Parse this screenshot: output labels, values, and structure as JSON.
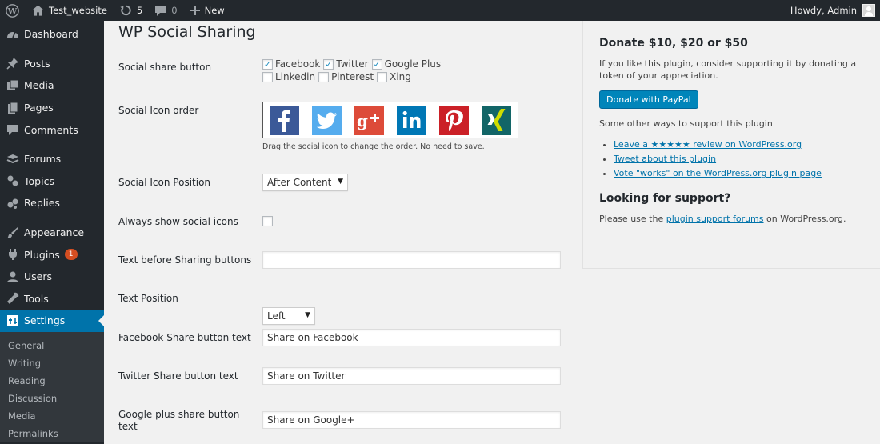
{
  "adminbar": {
    "site_name": "Test_website",
    "updates_count": "5",
    "comments_count": "0",
    "new_label": "New",
    "howdy": "Howdy, Admin"
  },
  "sidebar": {
    "items": [
      {
        "label": "Dashboard",
        "icon": "gauge-icon"
      },
      {
        "label": "Posts",
        "icon": "pin-icon"
      },
      {
        "label": "Media",
        "icon": "media-icon"
      },
      {
        "label": "Pages",
        "icon": "pages-icon"
      },
      {
        "label": "Comments",
        "icon": "comment-icon"
      },
      {
        "label": "Forums",
        "icon": "forums-icon"
      },
      {
        "label": "Topics",
        "icon": "topics-icon"
      },
      {
        "label": "Replies",
        "icon": "replies-icon"
      },
      {
        "label": "Appearance",
        "icon": "brush-icon"
      },
      {
        "label": "Plugins",
        "icon": "plug-icon",
        "badge": "1"
      },
      {
        "label": "Users",
        "icon": "user-icon"
      },
      {
        "label": "Tools",
        "icon": "wrench-icon"
      },
      {
        "label": "Settings",
        "icon": "settings-icon"
      }
    ],
    "submenu": [
      "General",
      "Writing",
      "Reading",
      "Discussion",
      "Media",
      "Permalinks"
    ]
  },
  "main": {
    "title": "WP Social Sharing",
    "social_share_button": {
      "label": "Social share button",
      "options": [
        {
          "label": "Facebook",
          "checked": true
        },
        {
          "label": "Twitter",
          "checked": true
        },
        {
          "label": "Google Plus",
          "checked": true
        },
        {
          "label": "Linkedin",
          "checked": false
        },
        {
          "label": "Pinterest",
          "checked": false
        },
        {
          "label": "Xing",
          "checked": false
        }
      ]
    },
    "icon_order": {
      "label": "Social Icon order",
      "icons": [
        {
          "name": "facebook-icon",
          "color": "#3b5998"
        },
        {
          "name": "twitter-icon",
          "color": "#55acee"
        },
        {
          "name": "google-plus-icon",
          "color": "#dd4b39"
        },
        {
          "name": "linkedin-icon",
          "color": "#0077b5"
        },
        {
          "name": "pinterest-icon",
          "color": "#cb2027"
        },
        {
          "name": "xing-icon",
          "color": "#126567"
        }
      ],
      "help": "Drag the social icon to change the order. No need to save."
    },
    "icon_position": {
      "label": "Social Icon Position",
      "value": "After Content"
    },
    "always_show": {
      "label": "Always show social icons",
      "checked": false
    },
    "text_before": {
      "label": "Text before Sharing buttons",
      "value": ""
    },
    "text_position": {
      "label": "Text Position",
      "value": "Left"
    },
    "facebook_text": {
      "label": "Facebook Share button text",
      "value": "Share on Facebook"
    },
    "twitter_text": {
      "label": "Twitter Share button text",
      "value": "Share on Twitter"
    },
    "google_text": {
      "label_1": "Google plus share button",
      "label_2": "text",
      "value": "Share on Google+"
    }
  },
  "panel": {
    "donate_title": "Donate $10, $20 or $50",
    "donate_text": "If you like this plugin, consider supporting it by donating a token of your appreciation.",
    "paypal_label": "Donate with PayPal",
    "other_ways": "Some other ways to support this plugin",
    "links": [
      "Leave a ★★★★★ review on WordPress.org",
      "Tweet about this plugin",
      "Vote \"works\" on the WordPress.org plugin page"
    ],
    "support_title": "Looking for support?",
    "support_pre": "Please use the ",
    "support_link": "plugin support forums",
    "support_post": " on WordPress.org."
  },
  "colors": {
    "adminbar_bg": "#23282d",
    "accent": "#0073aa",
    "button": "#0085ba",
    "badge": "#d54e21"
  }
}
